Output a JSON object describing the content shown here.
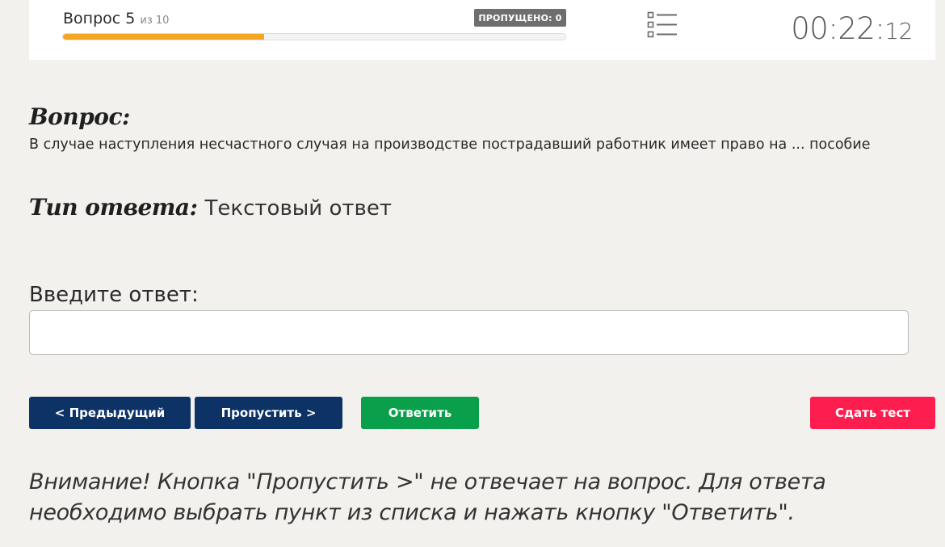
{
  "header": {
    "question_label": "Вопрос 5",
    "of_label": "из 10",
    "skipped_label": "ПРОПУЩЕНО: 0",
    "progress_fraction": 0.4,
    "progress_color": "#f5a623",
    "list_icon": "list-icon",
    "timer_main": "00:22:",
    "timer_seconds": "12"
  },
  "question": {
    "heading": "Вопрос:",
    "text": "В случае наступления несчастного случая на производстве пострадавший работник имеет право на ... пособие"
  },
  "answer_type": {
    "label": "Тип ответа:",
    "value": "Текстовый ответ"
  },
  "answer": {
    "label": "Введите ответ:",
    "value": "",
    "placeholder": ""
  },
  "buttons": {
    "prev_label": "< Предыдущий",
    "skip_label": "Пропустить >",
    "answer_label": "Ответить",
    "submit_label": "Сдать тест"
  },
  "colors": {
    "nav_button": "#0d3266",
    "answer_button": "#0a9f4b",
    "submit_button": "#fd1d4e",
    "background": "#f2f1ee"
  },
  "warning": "Внимание! Кнопка \"Пропустить >\" не отвечает на вопрос. Для ответа необходимо выбрать пункт из списка и нажать кнопку \"Ответить\"."
}
